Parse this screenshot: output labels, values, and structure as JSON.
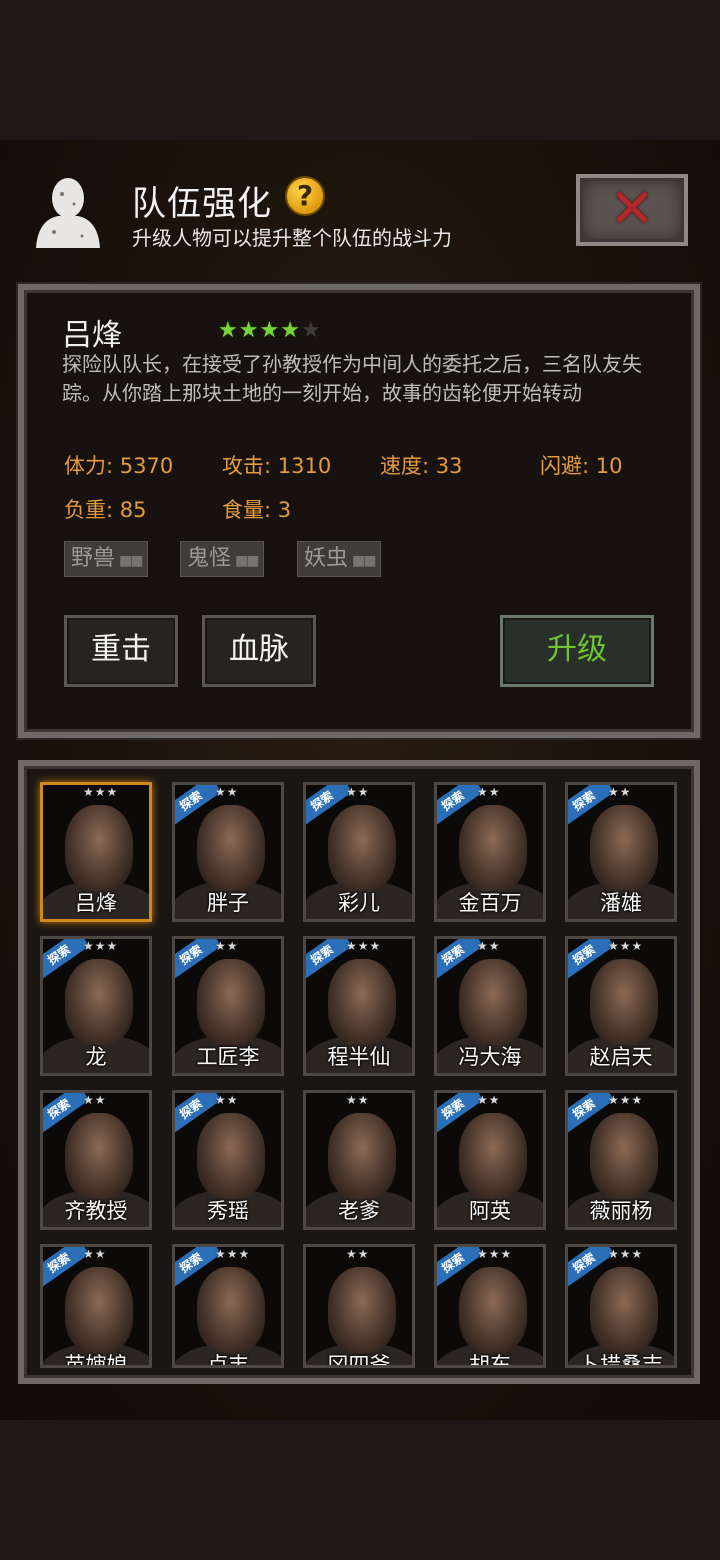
{
  "header": {
    "title": "队伍强化",
    "help": "?",
    "subtitle": "升级人物可以提升整个队伍的战斗力",
    "close": "✕"
  },
  "selected": {
    "name": "吕烽",
    "stars": 4,
    "max_stars": 5,
    "description": "探险队队长，在接受了孙教授作为中间人的委托之后，三名队友失踪。从你踏上那块土地的一刻开始，故事的齿轮便开始转动",
    "stats": [
      {
        "label": "体力: 5370"
      },
      {
        "label": "攻击: 1310"
      },
      {
        "label": "速度: 33"
      },
      {
        "label": "闪避: 10"
      },
      {
        "label": "负重: 85"
      },
      {
        "label": "食量: 3"
      }
    ],
    "tags": [
      "野兽",
      "鬼怪",
      "妖虫"
    ],
    "buttons": {
      "skill1": "重击",
      "skill2": "血脉",
      "upgrade": "升级"
    }
  },
  "roster": [
    {
      "name": "吕烽",
      "stars": "★★★",
      "badge": "",
      "selected": true
    },
    {
      "name": "胖子",
      "stars": "★★",
      "badge": "探索"
    },
    {
      "name": "彩儿",
      "stars": "★★",
      "badge": "探索"
    },
    {
      "name": "金百万",
      "stars": "★★",
      "badge": "探索"
    },
    {
      "name": "潘雄",
      "stars": "★★",
      "badge": "探索"
    },
    {
      "name": "龙",
      "stars": "★★★",
      "badge": "探索"
    },
    {
      "name": "工匠李",
      "stars": "★★",
      "badge": "探索"
    },
    {
      "name": "程半仙",
      "stars": "★★★",
      "badge": "探索"
    },
    {
      "name": "冯大海",
      "stars": "★★",
      "badge": "探索"
    },
    {
      "name": "赵启天",
      "stars": "★★★",
      "badge": "探索"
    },
    {
      "name": "齐教授",
      "stars": "★★",
      "badge": "探索"
    },
    {
      "name": "秀瑶",
      "stars": "★★",
      "badge": "探索"
    },
    {
      "name": "老爹",
      "stars": "★★",
      "badge": ""
    },
    {
      "name": "阿英",
      "stars": "★★",
      "badge": "探索"
    },
    {
      "name": "薇丽杨",
      "stars": "★★★",
      "badge": "探索"
    },
    {
      "name": "苗婶娘",
      "stars": "★★",
      "badge": "探索"
    },
    {
      "name": "卢丰",
      "stars": "★★★",
      "badge": "探索"
    },
    {
      "name": "冈四爷",
      "stars": "★★",
      "badge": ""
    },
    {
      "name": "胡东",
      "stars": "★★★",
      "badge": "探索"
    },
    {
      "name": "卜措桑吉",
      "stars": "★★★",
      "badge": "探索"
    }
  ]
}
